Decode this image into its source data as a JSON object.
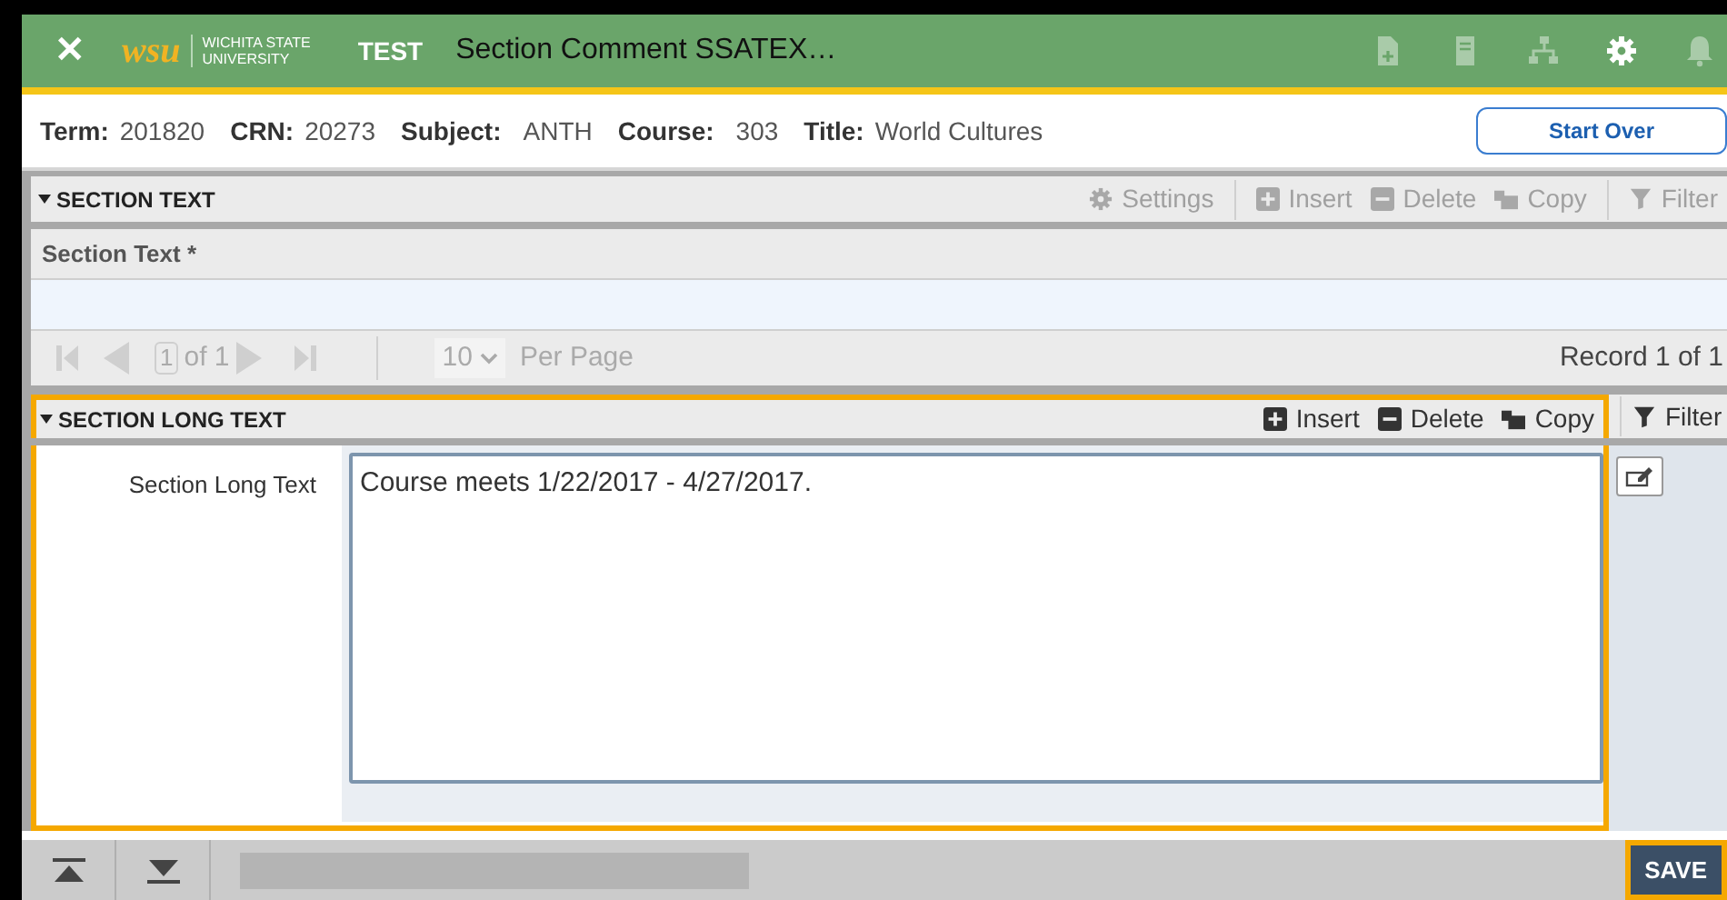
{
  "header": {
    "close": "✕",
    "logo_mark": "wsu",
    "logo_line_1": "WICHITA STATE",
    "logo_line_2": "UNIVERSITY",
    "environment": "TEST",
    "title": "Section Comment SSATEX…",
    "icons": [
      {
        "kind": "add-page",
        "disabled": true
      },
      {
        "kind": "page",
        "disabled": true
      },
      {
        "kind": "tree",
        "disabled": true
      },
      {
        "kind": "gear",
        "disabled": false
      },
      {
        "kind": "bell",
        "disabled": true
      }
    ]
  },
  "info_bar": {
    "fields": [
      {
        "label": "Term:",
        "value": "201820"
      },
      {
        "label": "CRN:",
        "value": "20273"
      },
      {
        "label": "Subject:",
        "value": "ANTH"
      },
      {
        "label": "Course:",
        "value": "303"
      },
      {
        "label": "Title:",
        "value": "World Cultures"
      }
    ],
    "button": "Start Over"
  },
  "section_text": {
    "title": "SECTION TEXT",
    "toolbar": [
      {
        "kind": "settings",
        "label": "Settings",
        "disabled": true
      },
      {
        "kind": "insert",
        "label": "Insert",
        "disabled": true
      },
      {
        "kind": "delete",
        "label": "Delete",
        "disabled": true
      },
      {
        "kind": "copy",
        "label": "Copy",
        "disabled": true
      },
      {
        "kind": "filter",
        "label": "Filter",
        "disabled": true
      }
    ],
    "column": "Section Text *",
    "pager": {
      "page": "1",
      "of": "of 1",
      "per_page": "10",
      "per_page_label": "Per Page",
      "record": "Record 1 of 1"
    }
  },
  "section_long_text": {
    "title": "SECTION LONG TEXT",
    "toolbar": [
      {
        "kind": "insert",
        "label": "Insert",
        "disabled": false
      },
      {
        "kind": "delete",
        "label": "Delete",
        "disabled": false
      },
      {
        "kind": "copy",
        "label": "Copy",
        "disabled": false
      },
      {
        "kind": "filter",
        "label": "Filter",
        "disabled": false
      }
    ],
    "field_label": "Section Long Text",
    "value": "Course meets 1/22/2017 - 4/27/2017."
  },
  "footer": {
    "save": "SAVE"
  }
}
